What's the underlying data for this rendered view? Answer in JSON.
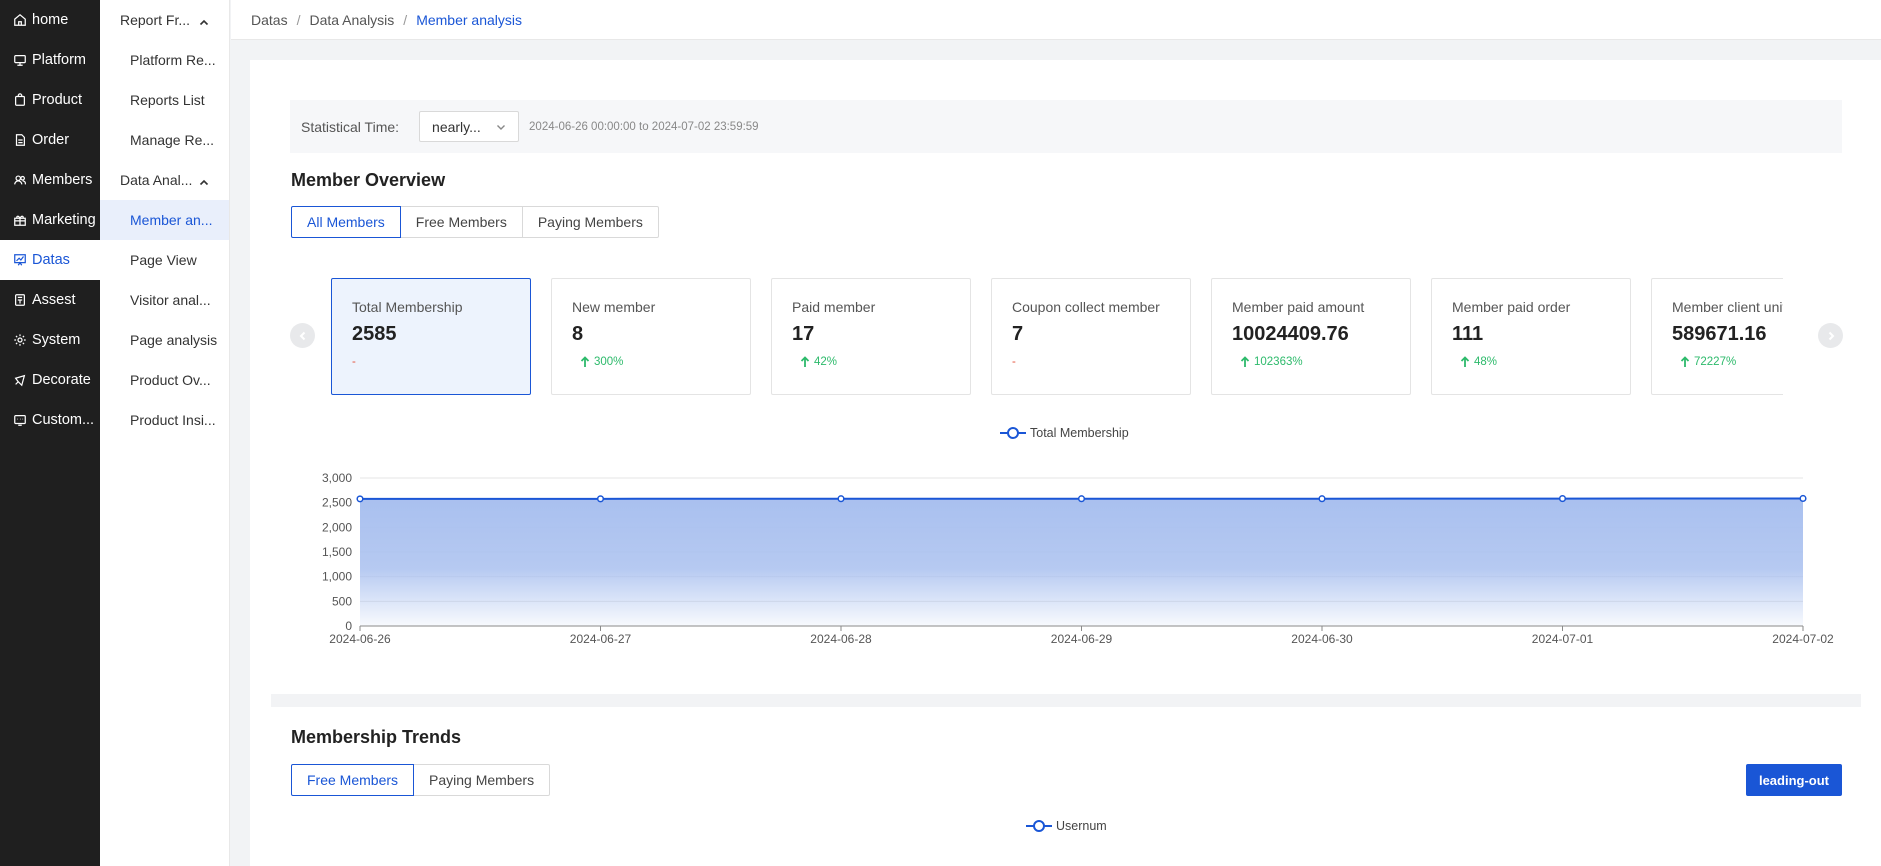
{
  "sidebar": {
    "items": [
      {
        "label": "home",
        "icon": "home-icon"
      },
      {
        "label": "Platform",
        "icon": "monitor-icon"
      },
      {
        "label": "Product",
        "icon": "bag-icon"
      },
      {
        "label": "Order",
        "icon": "document-icon"
      },
      {
        "label": "Members",
        "icon": "users-icon"
      },
      {
        "label": "Marketing",
        "icon": "gift-icon"
      },
      {
        "label": "Datas",
        "icon": "chart-board-icon"
      },
      {
        "label": "Assest",
        "icon": "ledger-icon"
      },
      {
        "label": "System",
        "icon": "gear-icon"
      },
      {
        "label": "Decorate",
        "icon": "brush-icon"
      },
      {
        "label": "Custom...",
        "icon": "service-icon"
      }
    ]
  },
  "subnav": {
    "group1": "Report Fr...",
    "group1_items": [
      "Platform Re...",
      "Reports List",
      "Manage Re..."
    ],
    "group2": "Data Anal...",
    "group2_items": [
      "Member an...",
      "Page View",
      "Visitor anal...",
      "Page analysis",
      "Product Ov...",
      "Product Insi..."
    ]
  },
  "breadcrumb": [
    "Datas",
    "Data Analysis",
    "Member analysis"
  ],
  "filter": {
    "label": "Statistical Time:",
    "select_value": "nearly...",
    "range_text": "2024-06-26 00:00:00 to 2024-07-02 23:59:59"
  },
  "overview": {
    "title": "Member Overview",
    "tabs": [
      "All Members",
      "Free Members",
      "Paying Members"
    ],
    "cards": [
      {
        "title": "Total Membership",
        "value": "2585",
        "change": "-",
        "trend": "none"
      },
      {
        "title": "New member",
        "value": "8",
        "change": "300%",
        "trend": "up"
      },
      {
        "title": "Paid member",
        "value": "17",
        "change": "42%",
        "trend": "up"
      },
      {
        "title": "Coupon collect member",
        "value": "7",
        "change": "-",
        "trend": "none"
      },
      {
        "title": "Member paid amount",
        "value": "10024409.76",
        "change": "102363%",
        "trend": "up"
      },
      {
        "title": "Member paid order",
        "value": "111",
        "change": "48%",
        "trend": "up"
      },
      {
        "title": "Member client unit price",
        "value": "589671.16",
        "change": "72227%",
        "trend": "up"
      }
    ]
  },
  "chart_data": {
    "type": "area",
    "legend": [
      "Total Membership"
    ],
    "x": [
      "2024-06-26",
      "2024-06-27",
      "2024-06-28",
      "2024-06-29",
      "2024-06-30",
      "2024-07-01",
      "2024-07-02"
    ],
    "series": [
      {
        "name": "Total Membership",
        "values": [
          2577,
          2578,
          2580,
          2580,
          2580,
          2583,
          2585
        ]
      }
    ],
    "ylim": [
      0,
      3000
    ],
    "yticks": [
      "0",
      "500",
      "1,000",
      "1,500",
      "2,000",
      "2,500",
      "3,000"
    ],
    "grid": true,
    "color": "#1a56d6",
    "fill": "#a9c0ef"
  },
  "trends": {
    "title": "Membership Trends",
    "tabs": [
      "Free Members",
      "Paying Members"
    ],
    "export_label": "leading-out",
    "legend": "Usernum"
  }
}
